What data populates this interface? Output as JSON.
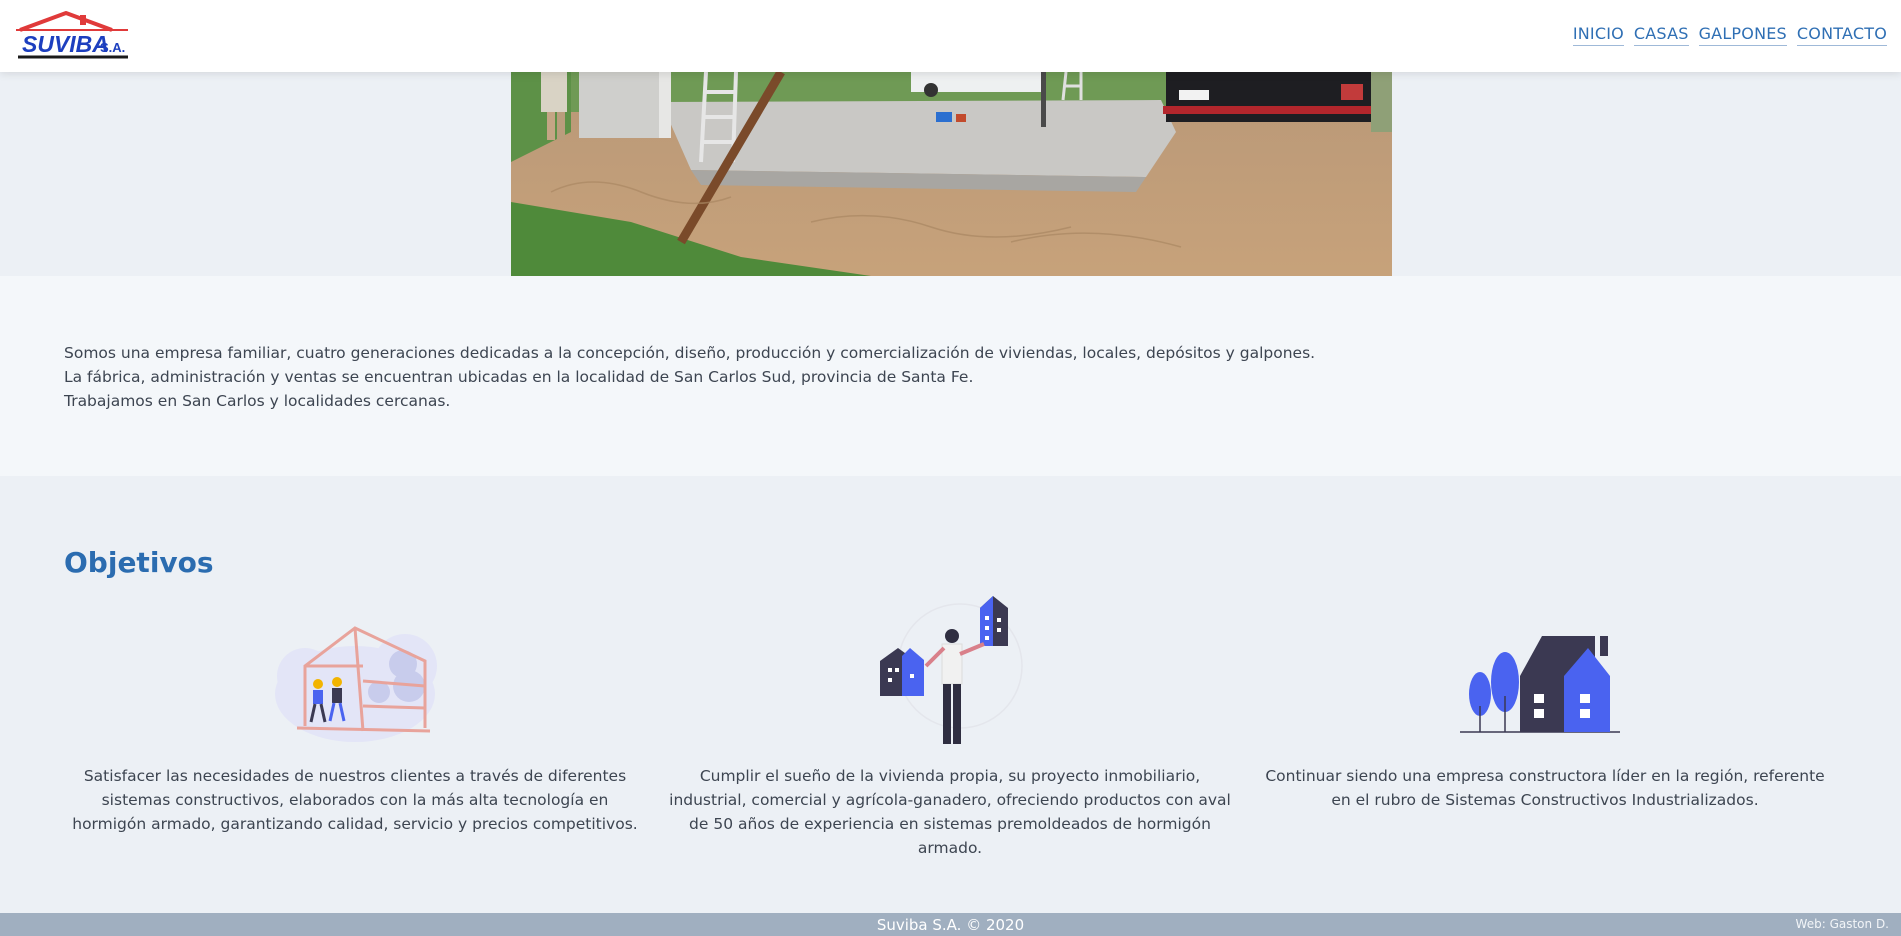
{
  "header": {
    "logo_text": "SUVIBA",
    "logo_suffix": "S.A.",
    "nav": [
      {
        "label": "INICIO"
      },
      {
        "label": "CASAS"
      },
      {
        "label": "GALPONES"
      },
      {
        "label": "CONTACTO"
      }
    ]
  },
  "intro": {
    "lines": [
      "Somos una empresa familiar, cuatro generaciones dedicadas a la concepción, diseño, producción y comercialización de viviendas, locales, depósitos y galpones.",
      "La fábrica, administración y ventas se encuentran ubicadas en la localidad de San Carlos Sud, provincia de Santa Fe.",
      "Trabajamos en San Carlos y localidades cercanas."
    ]
  },
  "objetivos": {
    "title": "Objetivos",
    "items": [
      {
        "icon": "construction-workers-icon",
        "text": "Satisfacer las necesidades de nuestros clientes a través de diferentes sistemas constructivos, elaborados con la más alta tecnología en hormigón armado, garantizando calidad, servicio y precios competitivos."
      },
      {
        "icon": "person-holding-buildings-icon",
        "text": "Cumplir el sueño de la vivienda propia, su proyecto inmobiliario, industrial, comercial y agrícola-ganadero, ofreciendo productos con aval de 50 años de experiencia en sistemas premoldeados de hormigón armado."
      },
      {
        "icon": "house-with-trees-icon",
        "text": "Continuar siendo una empresa constructora líder en la región, referente en el rubro de Sistemas Constructivos Industrializados."
      }
    ]
  },
  "footer": {
    "copyright": "Suviba S.A. © 2020",
    "credit": "Web: Gaston D."
  },
  "colors": {
    "accent": "#2b6cb0",
    "footer_bg": "#a0afc0",
    "illustration_blue": "#4a63f0",
    "illustration_dark": "#3b3952"
  }
}
